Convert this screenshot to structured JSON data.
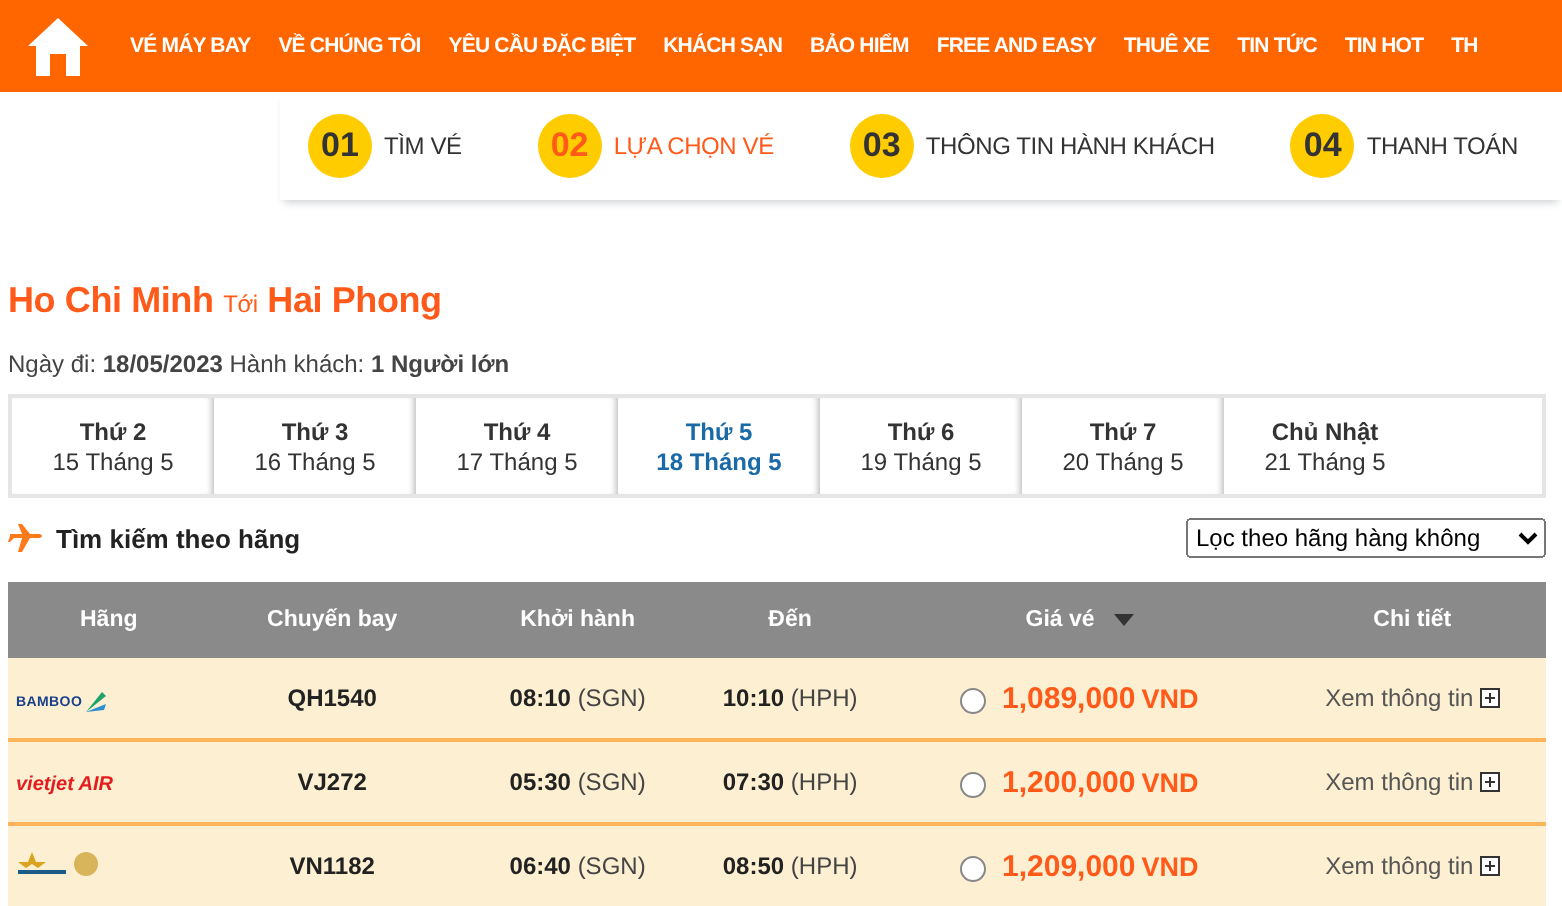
{
  "nav": {
    "items": [
      "VÉ MÁY BAY",
      "VỀ CHÚNG TÔI",
      "YÊU CẦU ĐẶC BIỆT",
      "KHÁCH SẠN",
      "BẢO HIỂM",
      "FREE AND EASY",
      "THUÊ XE",
      "TIN TỨC",
      "TIN HOT",
      "TH"
    ]
  },
  "steps": [
    {
      "number": "01",
      "label": "TÌM VÉ",
      "selected": false
    },
    {
      "number": "02",
      "label": "LỰA CHỌN VÉ",
      "selected": true
    },
    {
      "number": "03",
      "label": "THÔNG TIN HÀNH KHÁCH",
      "selected": false
    },
    {
      "number": "04",
      "label": "THANH TOÁN",
      "selected": false
    }
  ],
  "route": {
    "from": "Ho Chi Minh",
    "connector": "Tới",
    "to": "Hai Phong"
  },
  "trip_info": "Ngày đi: **18/05/2023** Hành khách: **1 Người lớn**",
  "dates": [
    {
      "day": "Thứ 2",
      "date": "15 Tháng 5",
      "selected": false
    },
    {
      "day": "Thứ 3",
      "date": "16 Tháng 5",
      "selected": false
    },
    {
      "day": "Thứ 4",
      "date": "17 Tháng 5",
      "selected": false
    },
    {
      "day": "Thứ 5",
      "date": "18 Tháng 5",
      "selected": true
    },
    {
      "day": "Thứ 6",
      "date": "19 Tháng 5",
      "selected": false
    },
    {
      "day": "Thứ 7",
      "date": "20 Tháng 5",
      "selected": false
    },
    {
      "day": "Chủ Nhật",
      "date": "21 Tháng 5",
      "selected": false
    }
  ],
  "airline_search": {
    "label": "Tìm kiếm theo hãng",
    "filter": "Lọc theo hãng hàng không"
  },
  "table": {
    "columns": [
      "Hãng",
      "Chuyến bay",
      "Khởi hành",
      "Đến",
      "Giá vé",
      "Chi tiết"
    ],
    "rows": [
      {
        "kind": "bamboo",
        "logo_text": "BAMBOO",
        "flight": "QH1540",
        "depart_time": "08:10",
        "depart_code": "(SGN)",
        "arrive_time": "10:10",
        "arrive_code": "(HPH)",
        "price": "1,089,000",
        "currency": "VND",
        "selected": false,
        "detail": "Xem thông tin"
      },
      {
        "kind": "vietjet",
        "logo_text": "vietjet AIR",
        "flight": "VJ272",
        "depart_time": "05:30",
        "depart_code": "(SGN)",
        "arrive_time": "07:30",
        "arrive_code": "(HPH)",
        "price": "1,200,000",
        "currency": "VND",
        "selected": false,
        "detail": "Xem thông tin"
      },
      {
        "kind": "vietnam",
        "flight": "VN1182",
        "depart_time": "06:40",
        "depart_code": "(SGN)",
        "arrive_time": "08:50",
        "arrive_code": "(HPH)",
        "price": "1,209,000",
        "currency": "VND",
        "selected": false,
        "detail": "Xem thông tin"
      }
    ]
  }
}
